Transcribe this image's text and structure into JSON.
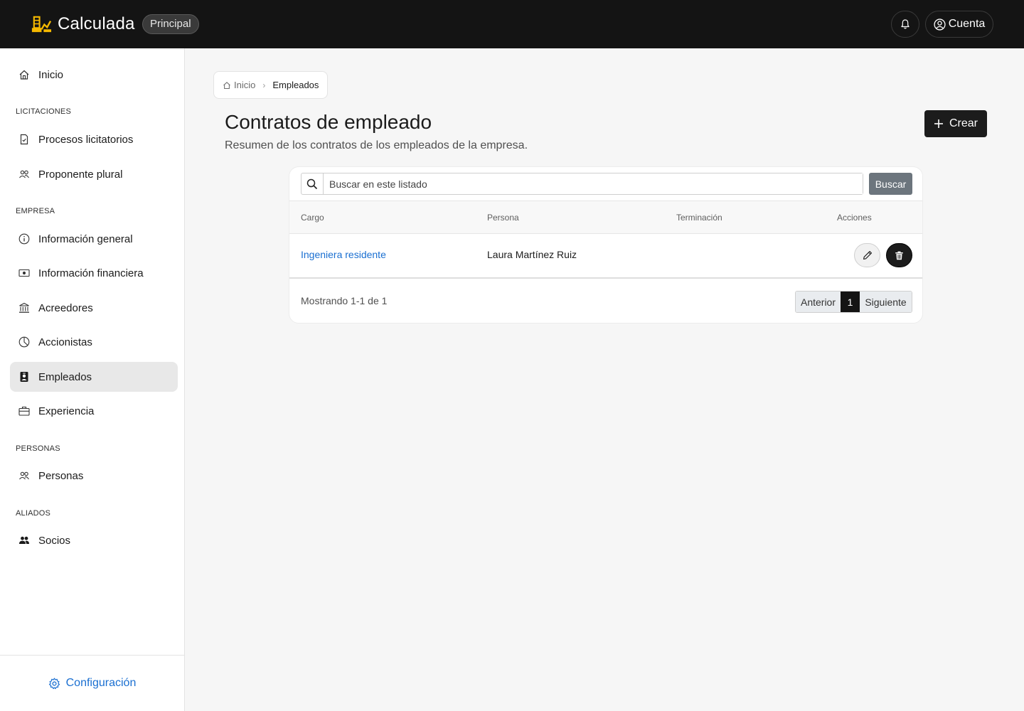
{
  "app": {
    "name": "Calculada",
    "environment": "Principal",
    "account_label": "Cuenta",
    "colors": {
      "topbar": "#141414",
      "brand_logo": "#f5b800",
      "link": "#1a6fd1",
      "primary_button": "#1c1c1c",
      "secondary_button": "#6c757d"
    }
  },
  "sidebar": {
    "home": {
      "label": "Inicio",
      "icon": "home-icon"
    },
    "sections": [
      {
        "label": "LICITACIONES",
        "items": [
          {
            "label": "Procesos licitatorios",
            "icon": "file-check-icon"
          },
          {
            "label": "Proponente plural",
            "icon": "people-icon"
          }
        ]
      },
      {
        "label": "EMPRESA",
        "items": [
          {
            "label": "Información general",
            "icon": "info-circle-icon"
          },
          {
            "label": "Información financiera",
            "icon": "cash-icon"
          },
          {
            "label": "Acreedores",
            "icon": "bank-icon"
          },
          {
            "label": "Accionistas",
            "icon": "pie-chart-icon"
          },
          {
            "label": "Empleados",
            "icon": "person-badge-icon",
            "active": true
          },
          {
            "label": "Experiencia",
            "icon": "briefcase-icon"
          }
        ]
      },
      {
        "label": "PERSONAS",
        "items": [
          {
            "label": "Personas",
            "icon": "people-icon"
          }
        ]
      },
      {
        "label": "ALIADOS",
        "items": [
          {
            "label": "Socios",
            "icon": "people-fill-icon"
          }
        ]
      }
    ],
    "footer": {
      "label": "Configuración",
      "icon": "gear-icon"
    }
  },
  "breadcrumb": {
    "home": "Inicio",
    "current": "Empleados"
  },
  "page": {
    "title": "Contratos de empleado",
    "subtitle": "Resumen de los contratos de los empleados de la empresa.",
    "create_label": "Crear"
  },
  "search": {
    "placeholder": "Buscar en este listado",
    "button_label": "Buscar"
  },
  "table": {
    "columns": [
      "Cargo",
      "Persona",
      "Terminación",
      "Acciones"
    ],
    "rows": [
      {
        "cargo": "Ingeniera residente",
        "persona": "Laura Martínez Ruiz",
        "terminacion": ""
      }
    ]
  },
  "pagination": {
    "summary": "Mostrando 1-1 de 1",
    "previous": "Anterior",
    "current": "1",
    "next": "Siguiente"
  }
}
